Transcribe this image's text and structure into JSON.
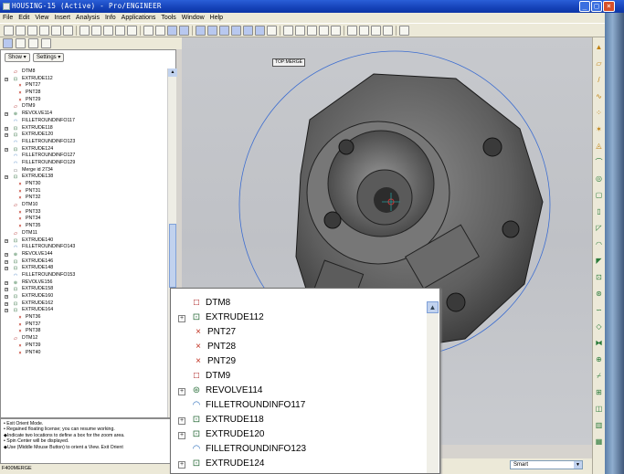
{
  "window": {
    "title": "HOUSING-15 (Active) - Pro/ENGINEER",
    "controls": [
      "_",
      "□",
      "×"
    ]
  },
  "menu": [
    "File",
    "Edit",
    "View",
    "Insert",
    "Analysis",
    "Info",
    "Applications",
    "Tools",
    "Window",
    "Help"
  ],
  "tree_panel": {
    "show_button": "Show ▾",
    "settings_button": "Settings ▾",
    "items": [
      {
        "label": "DTM8",
        "type": "dtm",
        "level": 1
      },
      {
        "label": "EXTRUDE112",
        "type": "ext",
        "level": 1,
        "expand": "+"
      },
      {
        "label": "PNT27",
        "type": "pnt",
        "level": 2
      },
      {
        "label": "PNT28",
        "type": "pnt",
        "level": 2
      },
      {
        "label": "PNT29",
        "type": "pnt",
        "level": 2
      },
      {
        "label": "DTM9",
        "type": "dtm",
        "level": 1
      },
      {
        "label": "REVOLVE114",
        "type": "rev",
        "level": 1,
        "expand": "+"
      },
      {
        "label": "FILLETROUNDINFO117",
        "type": "fil",
        "level": 1
      },
      {
        "label": "EXTRUDE118",
        "type": "ext",
        "level": 1,
        "expand": "+"
      },
      {
        "label": "EXTRUDE120",
        "type": "ext",
        "level": 1,
        "expand": "+"
      },
      {
        "label": "FILLETROUNDINFO123",
        "type": "fil",
        "level": 1
      },
      {
        "label": "EXTRUDE124",
        "type": "ext",
        "level": 1,
        "expand": "+"
      },
      {
        "label": "FILLETROUNDINFO127",
        "type": "fil",
        "level": 1
      },
      {
        "label": "FILLETROUNDINFO129",
        "type": "fil",
        "level": 1
      },
      {
        "label": "Merge id 2734",
        "type": "mer",
        "level": 1
      },
      {
        "label": "EXTRUDE138",
        "type": "ext",
        "level": 1,
        "expand": "+"
      },
      {
        "label": "PNT30",
        "type": "pnt",
        "level": 2
      },
      {
        "label": "PNT31",
        "type": "pnt",
        "level": 2
      },
      {
        "label": "PNT32",
        "type": "pnt",
        "level": 2
      },
      {
        "label": "DTM10",
        "type": "dtm",
        "level": 1
      },
      {
        "label": "PNT33",
        "type": "pnt",
        "level": 2
      },
      {
        "label": "PNT34",
        "type": "pnt",
        "level": 2
      },
      {
        "label": "PNT35",
        "type": "pnt",
        "level": 2
      },
      {
        "label": "DTM11",
        "type": "dtm",
        "level": 1
      },
      {
        "label": "EXTRUDE140",
        "type": "ext",
        "level": 1,
        "expand": "+"
      },
      {
        "label": "FILLETROUNDINFO143",
        "type": "fil",
        "level": 1
      },
      {
        "label": "REVOLVE144",
        "type": "rev",
        "level": 1,
        "expand": "+"
      },
      {
        "label": "EXTRUDE146",
        "type": "ext",
        "level": 1,
        "expand": "+"
      },
      {
        "label": "EXTRUDE148",
        "type": "ext",
        "level": 1,
        "expand": "+"
      },
      {
        "label": "FILLETROUNDINFO153",
        "type": "fil",
        "level": 1
      },
      {
        "label": "REVOLVE156",
        "type": "rev",
        "level": 1,
        "expand": "+"
      },
      {
        "label": "EXTRUDE158",
        "type": "ext",
        "level": 1,
        "expand": "+"
      },
      {
        "label": "EXTRUDE160",
        "type": "ext",
        "level": 1,
        "expand": "+"
      },
      {
        "label": "EXTRUDE162",
        "type": "ext",
        "level": 1,
        "expand": "+"
      },
      {
        "label": "EXTRUDE164",
        "type": "ext",
        "level": 1,
        "expand": "+"
      },
      {
        "label": "PNT36",
        "type": "pnt",
        "level": 2
      },
      {
        "label": "PNT37",
        "type": "pnt",
        "level": 2
      },
      {
        "label": "PNT38",
        "type": "pnt",
        "level": 2
      },
      {
        "label": "DTM12",
        "type": "dtm",
        "level": 1
      },
      {
        "label": "PNT39",
        "type": "pnt",
        "level": 2
      },
      {
        "label": "PNT40",
        "type": "pnt",
        "level": 2
      }
    ]
  },
  "messages": [
    "• Exit Orient Mode.",
    "• Regained floating license; you can resume working.",
    "◆Indicate two locations to define a box for the zoom area.",
    "• Spin Center will be displayed.",
    "◆Use (Middle Mouse Button) to orient a  View.  Exit Orient"
  ],
  "status_left": "F400MERGE",
  "view_label": "TOP:MERGE",
  "filter_select": "Smart",
  "zoom_popup": {
    "items": [
      {
        "label": "DTM8",
        "icon": "□",
        "type": "dtm",
        "expand": ""
      },
      {
        "label": "EXTRUDE112",
        "icon": "⊡",
        "type": "ext",
        "expand": "+"
      },
      {
        "label": "PNT27",
        "icon": "×",
        "type": "pnt",
        "expand": ""
      },
      {
        "label": "PNT28",
        "icon": "×",
        "type": "pnt",
        "expand": ""
      },
      {
        "label": "PNT29",
        "icon": "×",
        "type": "pnt",
        "expand": ""
      },
      {
        "label": "DTM9",
        "icon": "□",
        "type": "dtm",
        "expand": ""
      },
      {
        "label": "REVOLVE114",
        "icon": "⊛",
        "type": "rev",
        "expand": "+"
      },
      {
        "label": "FILLETROUNDINFO117",
        "icon": "◠",
        "type": "fil",
        "expand": ""
      },
      {
        "label": "EXTRUDE118",
        "icon": "⊡",
        "type": "ext",
        "expand": "+"
      },
      {
        "label": "EXTRUDE120",
        "icon": "⊡",
        "type": "ext",
        "expand": "+"
      },
      {
        "label": "FILLETROUNDINFO123",
        "icon": "◠",
        "type": "fil",
        "expand": ""
      },
      {
        "label": "EXTRUDE124",
        "icon": "⊡",
        "type": "ext",
        "expand": "+"
      },
      {
        "label": "FILLETROUNDINFO127",
        "icon": "◠",
        "type": "fil",
        "expand": ""
      }
    ]
  }
}
